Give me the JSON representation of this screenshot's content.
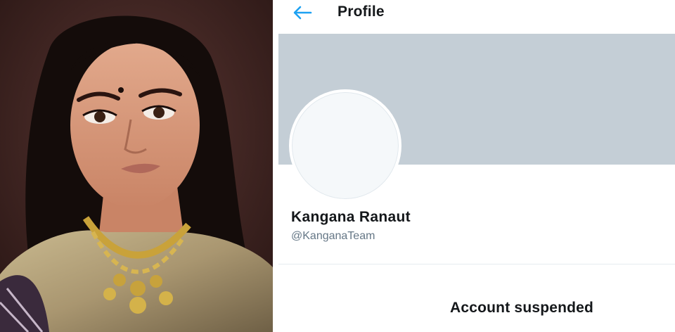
{
  "photo": {
    "icon": "person-photo"
  },
  "profile": {
    "header": {
      "back_icon": "back-arrow-icon",
      "title": "Profile"
    },
    "banner_color": "#c4ced6",
    "accent_color": "#1da1f2",
    "display_name": "Kangana Ranaut",
    "handle": "@KanganaTeam",
    "status_title": "Account suspended"
  }
}
